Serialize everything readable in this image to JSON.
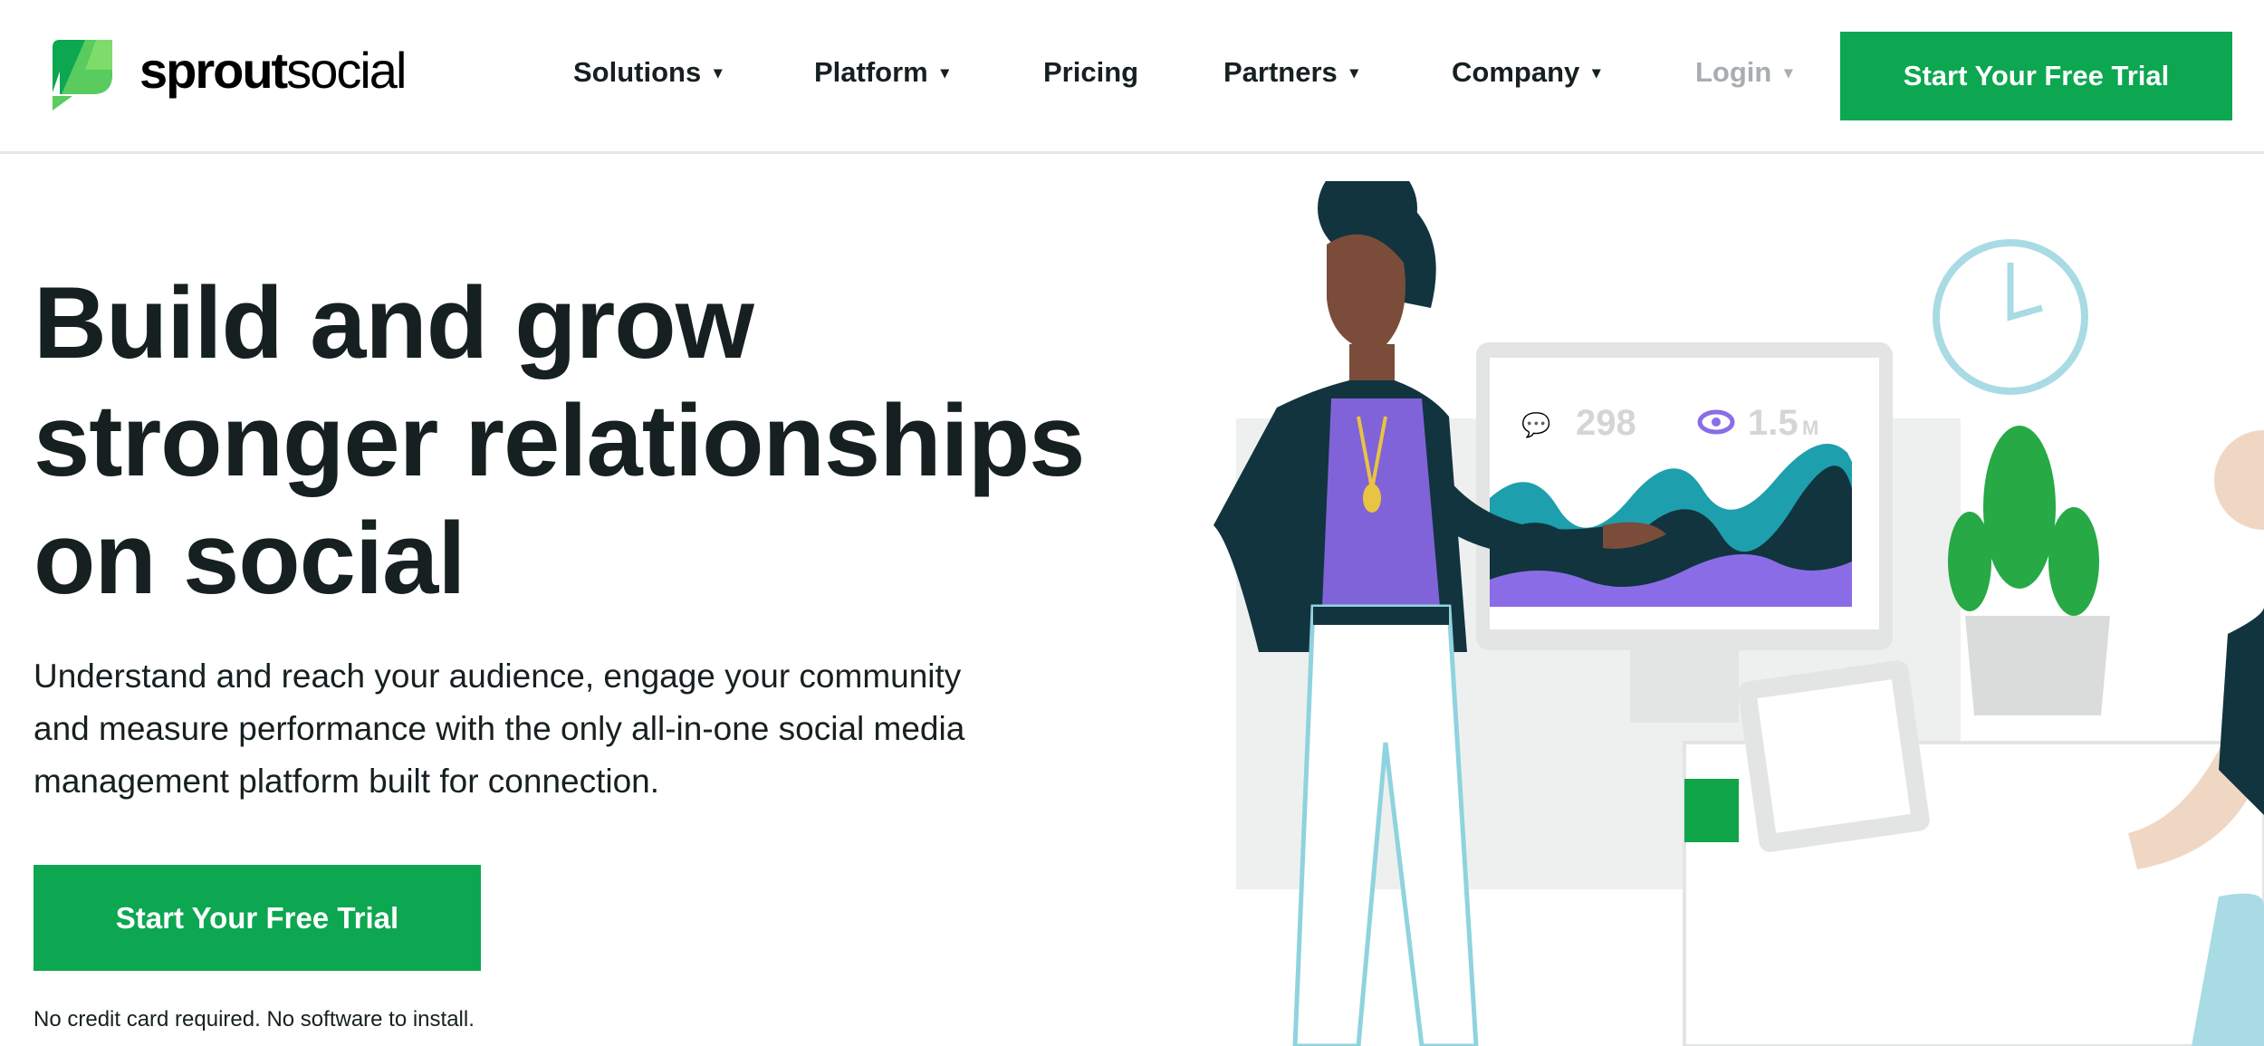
{
  "header": {
    "logo": {
      "bold": "sprout",
      "light": "social"
    },
    "nav": [
      {
        "label": "Solutions",
        "dropdown": true
      },
      {
        "label": "Platform",
        "dropdown": true
      },
      {
        "label": "Pricing",
        "dropdown": false
      },
      {
        "label": "Partners",
        "dropdown": true
      },
      {
        "label": "Company",
        "dropdown": true
      },
      {
        "label": "Login",
        "dropdown": true
      }
    ],
    "caret": "▾",
    "cta": "Start Your Free Trial"
  },
  "hero": {
    "title_lines": [
      "Build and grow",
      "stronger relationships",
      "on social"
    ],
    "subtitle_lines": [
      "Understand and reach your audience, engage your community",
      "and measure performance with the only all-in-one social media",
      "management platform built for connection."
    ],
    "cta": "Start Your Free Trial",
    "note": "No credit card required. No software to install."
  },
  "illustration": {
    "comments": "298",
    "views": "1.5",
    "views_unit": "M"
  },
  "colors": {
    "brand_green": "#0ca750",
    "text": "#162020",
    "login_gray": "#a8adb0"
  }
}
